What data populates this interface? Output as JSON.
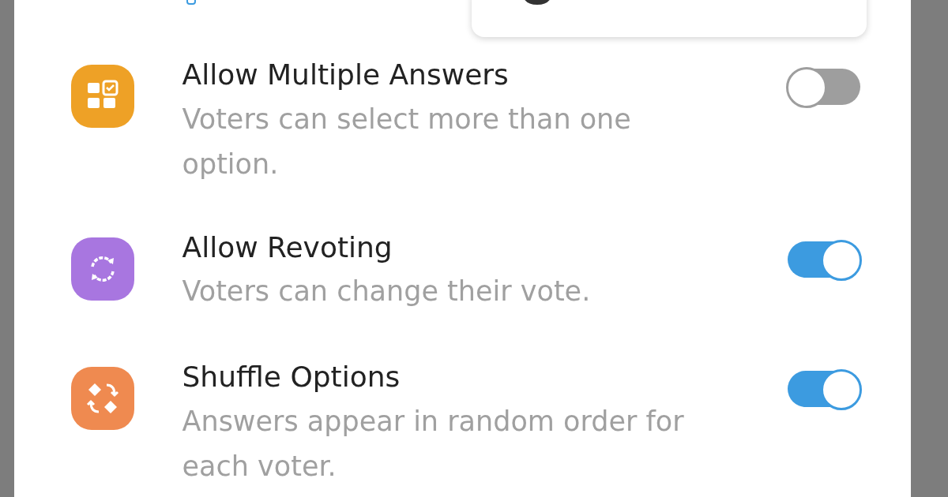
{
  "settings": [
    {
      "kind": "multiple",
      "color": "#eea126",
      "title": "Allow Multiple Answers",
      "description": "Voters can select more than one option.",
      "on": false
    },
    {
      "kind": "revote",
      "color": "#a876e0",
      "title": "Allow Revoting",
      "description": "Voters can change their vote.",
      "on": true
    },
    {
      "kind": "shuffle",
      "color": "#ef8a50",
      "title": "Shuffle Options",
      "description": "Answers appear in random order for each voter.",
      "on": true
    }
  ]
}
